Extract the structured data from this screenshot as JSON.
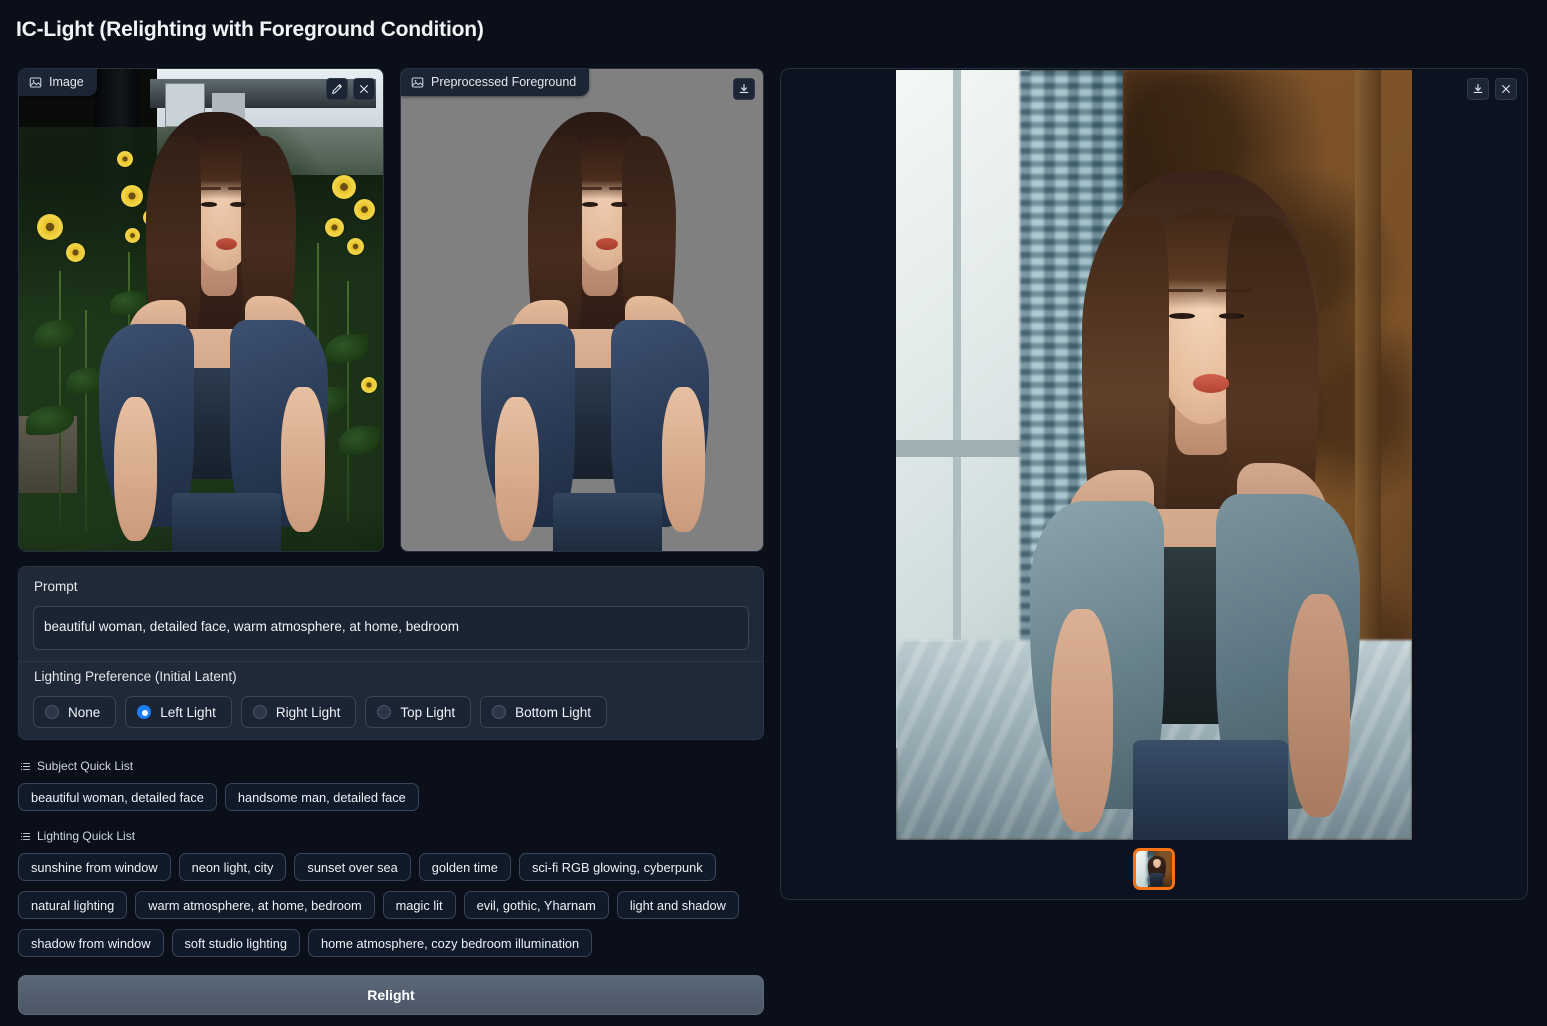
{
  "app": {
    "title": "IC-Light (Relighting with Foreground Condition)"
  },
  "input_panel": {
    "label": "Image",
    "label_icon": "image-icon",
    "edit_icon": "pencil-icon",
    "close_icon": "close-icon"
  },
  "foreground_panel": {
    "label": "Preprocessed Foreground",
    "label_icon": "image-icon",
    "download_icon": "download-icon"
  },
  "prompt": {
    "label": "Prompt",
    "value": "beautiful woman, detailed face, warm atmosphere, at home, bedroom",
    "placeholder": "Prompt"
  },
  "lighting": {
    "label": "Lighting Preference (Initial Latent)",
    "selected": "Left Light",
    "options": [
      {
        "label": "None",
        "selected": false
      },
      {
        "label": "Left Light",
        "selected": true
      },
      {
        "label": "Right Light",
        "selected": false
      },
      {
        "label": "Top Light",
        "selected": false
      },
      {
        "label": "Bottom Light",
        "selected": false
      }
    ]
  },
  "subject_quick_list": {
    "label": "Subject Quick List",
    "icon": "list-icon",
    "items": [
      "beautiful woman, detailed face",
      "handsome man, detailed face"
    ]
  },
  "lighting_quick_list": {
    "label": "Lighting Quick List",
    "icon": "list-icon",
    "rows": [
      [
        "sunshine from window",
        "neon light, city",
        "sunset over sea",
        "golden time",
        "sci-fi RGB glowing, cyberpunk"
      ],
      [
        "natural lighting",
        "warm atmosphere, at home, bedroom",
        "magic lit",
        "evil, gothic, Yharnam",
        "light and shadow"
      ],
      [
        "shadow from window",
        "soft studio lighting",
        "home atmosphere, cozy bedroom illumination"
      ]
    ]
  },
  "actions": {
    "relight_label": "Relight"
  },
  "output_panel": {
    "download_icon": "download-icon",
    "close_icon": "close-icon",
    "gallery_selected_index": 0,
    "selection_color": "#f97316"
  },
  "colors": {
    "background": "#0b0f19",
    "panel": "#1f2937",
    "panel_border": "#2a3646",
    "accent_radio": "#1a7ef5",
    "accent_selection": "#f97316",
    "button": "#4b5766",
    "text": "#e5e7eb",
    "foreground_mask_bg": "#808080"
  }
}
